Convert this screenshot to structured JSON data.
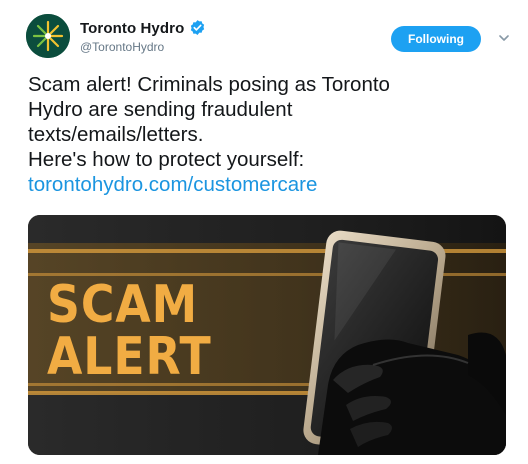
{
  "account": {
    "name": "Toronto Hydro",
    "handle": "@TorontoHydro",
    "verified": true,
    "avatar_icon": "toronto-hydro-logo-icon"
  },
  "actions": {
    "follow_label": "Following",
    "menu_icon": "chevron-down-icon"
  },
  "tweet": {
    "lines": [
      "Scam alert! Criminals posing as Toronto",
      "Hydro are sending fraudulent",
      "texts/emails/letters.",
      "Here's how to protect yourself:"
    ],
    "link": "torontohydro.com/customercare"
  },
  "media": {
    "headline_line1": "SCAM",
    "headline_line2": "ALERT"
  },
  "colors": {
    "follow_button": "#1da1f2",
    "link": "#1b95e0",
    "alert_orange": "#f1ac43",
    "avatar_bg": "#0b4d3d"
  }
}
